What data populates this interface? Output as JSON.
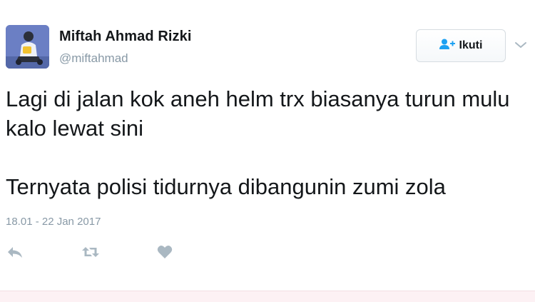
{
  "user": {
    "name": "Miftah Ahmad Rizki",
    "handle": "@miftahmad",
    "avatar_icon": "user-avatar"
  },
  "follow": {
    "label": "Ikuti",
    "icon": "add-user-icon"
  },
  "menu": {
    "icon": "chevron-down-icon"
  },
  "tweet": {
    "line1": "Lagi di jalan kok aneh helm trx biasanya turun mulu kalo lewat sini",
    "line2": "Ternyata polisi tidurnya dibangunin zumi zola",
    "timestamp": "18.01 - 22 Jan 2017"
  },
  "actions": {
    "reply_icon": "reply-icon",
    "retweet_icon": "retweet-icon",
    "like_icon": "heart-icon"
  },
  "colors": {
    "text": "#14171a",
    "muted": "#8899a6",
    "follow_icon": "#1da1f2",
    "icon_gray": "#aab8c2"
  }
}
